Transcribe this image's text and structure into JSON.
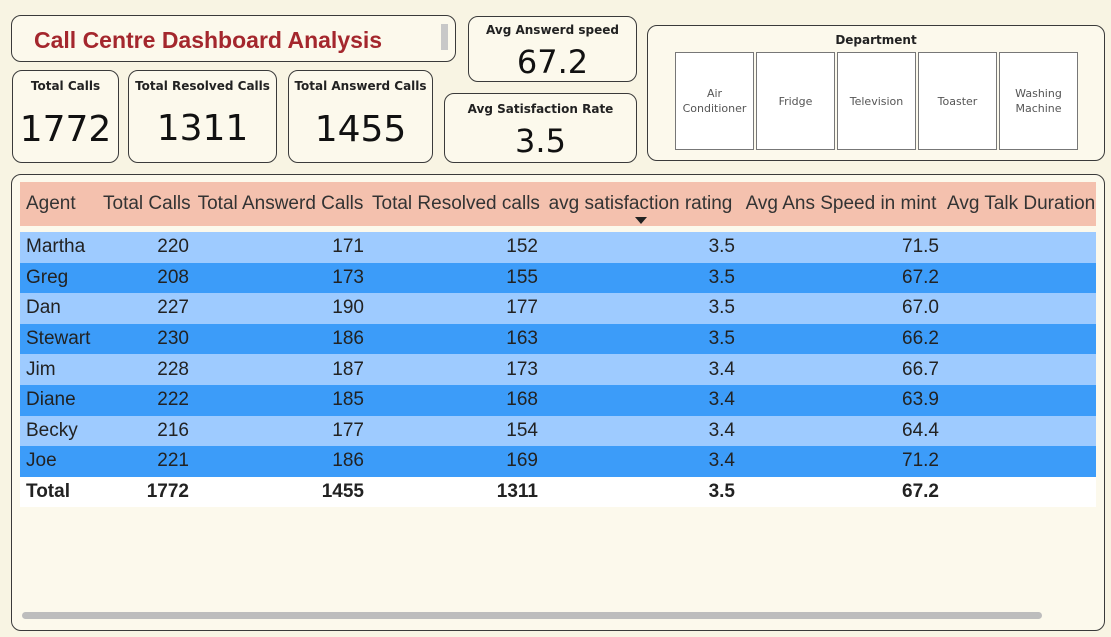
{
  "title": "Call Centre Dashboard Analysis",
  "kpis": {
    "total_calls": {
      "label": "Total Calls",
      "value": "1772"
    },
    "total_resolved": {
      "label": "Total Resolved Calls",
      "value": "1311"
    },
    "total_answered": {
      "label": "Total Answerd Calls",
      "value": "1455"
    },
    "avg_speed": {
      "label": "Avg Answerd speed",
      "value": "67.2"
    },
    "avg_satisfaction": {
      "label": "Avg Satisfaction Rate",
      "value": "3.5"
    }
  },
  "department": {
    "title": "Department",
    "options": [
      "Air Conditioner",
      "Fridge",
      "Television",
      "Toaster",
      "Washing Machine"
    ]
  },
  "table": {
    "columns": [
      "Agent",
      "Total Calls",
      "Total Answerd Calls",
      "Total Resolved calls",
      "avg satisfaction rating",
      "Avg Ans Speed in mint",
      "Avg Talk Duration"
    ],
    "sorted_column": "avg satisfaction rating",
    "rows": [
      [
        "Martha",
        "220",
        "171",
        "152",
        "3.5",
        "71.5",
        ""
      ],
      [
        "Greg",
        "208",
        "173",
        "155",
        "3.5",
        "67.2",
        ""
      ],
      [
        "Dan",
        "227",
        "190",
        "177",
        "3.5",
        "67.0",
        ""
      ],
      [
        "Stewart",
        "230",
        "186",
        "163",
        "3.5",
        "66.2",
        ""
      ],
      [
        "Jim",
        "228",
        "187",
        "173",
        "3.4",
        "66.7",
        ""
      ],
      [
        "Diane",
        "222",
        "185",
        "168",
        "3.4",
        "63.9",
        ""
      ],
      [
        "Becky",
        "216",
        "177",
        "154",
        "3.4",
        "64.4",
        ""
      ],
      [
        "Joe",
        "221",
        "186",
        "169",
        "3.4",
        "71.2",
        ""
      ]
    ],
    "total": [
      "Total",
      "1772",
      "1455",
      "1311",
      "3.5",
      "67.2",
      ""
    ]
  },
  "colors": {
    "title": "#a4272d",
    "header_bg": "#f4c1ae",
    "row_light": "#9ecbff",
    "row_dark": "#3c9cf9",
    "background": "#f8f4e3"
  }
}
